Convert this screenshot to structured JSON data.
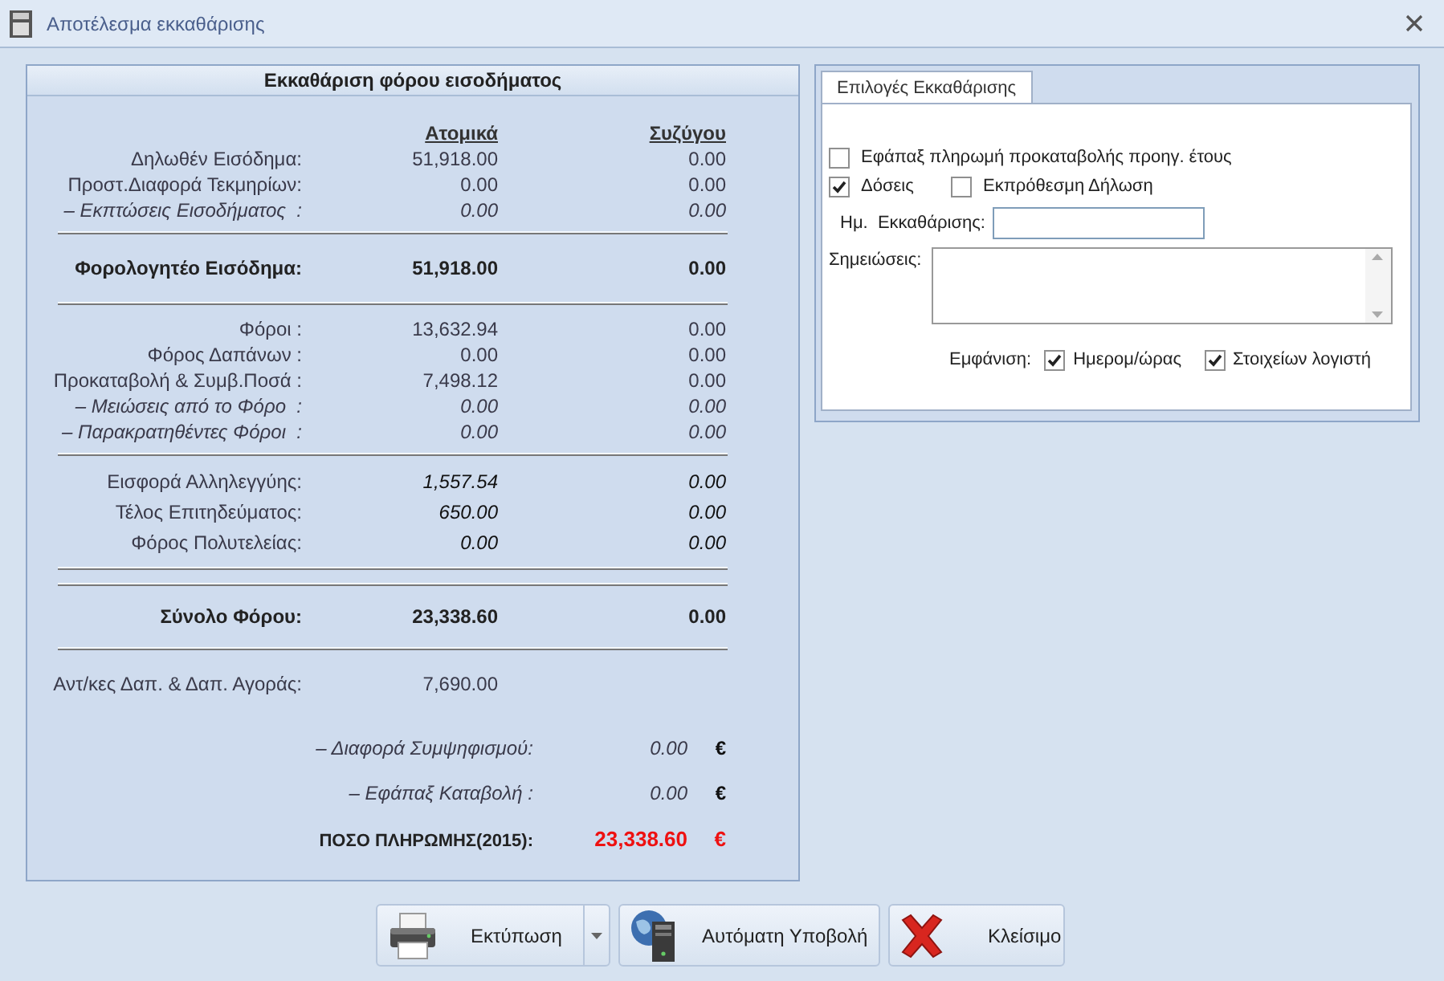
{
  "window": {
    "title": "Αποτέλεσμα εκκαθάρισης"
  },
  "summary": {
    "title": "Εκκαθάριση φόρου εισοδήματος",
    "columns": [
      "Ατομικά",
      "Συζύγου"
    ],
    "sections": [
      {
        "rows": [
          {
            "kind": "plain",
            "label": "Δηλωθέν Εισόδημα:",
            "individual": "51,918.00",
            "spouse": "0.00"
          },
          {
            "kind": "plain",
            "label": "Προστ.Διαφορά Τεκμηρίων:",
            "individual": "0.00",
            "spouse": "0.00"
          },
          {
            "kind": "deduction",
            "label": "– Εκπτώσεις Εισοδήματος  :",
            "individual": "0.00",
            "spouse": "0.00"
          }
        ]
      },
      {
        "rows": [
          {
            "kind": "total",
            "label": "Φορολογητέο Εισόδημα:",
            "individual": "51,918.00",
            "spouse": "0.00"
          }
        ]
      },
      {
        "rows": [
          {
            "kind": "plain",
            "label": "Φόροι :",
            "individual": "13,632.94",
            "spouse": "0.00"
          },
          {
            "kind": "plain",
            "label": "Φόρος Δαπάνων :",
            "individual": "0.00",
            "spouse": "0.00"
          },
          {
            "kind": "plain",
            "label": "Προκαταβολή & Συμβ.Ποσά :",
            "individual": "7,498.12",
            "spouse": "0.00"
          },
          {
            "kind": "deduction",
            "label": "– Μειώσεις από το Φόρο  :",
            "individual": "0.00",
            "spouse": "0.00"
          },
          {
            "kind": "deduction",
            "label": "– Παρακρατηθέντες Φόροι  :",
            "individual": "0.00",
            "spouse": "0.00"
          }
        ]
      },
      {
        "rows": [
          {
            "kind": "levy",
            "label": "Εισφορά Αλληλεγγύης:",
            "individual": "1,557.54",
            "spouse": "0.00"
          },
          {
            "kind": "levy",
            "label": "Τέλος Επιτηδεύματος:",
            "individual": "650.00",
            "spouse": "0.00"
          },
          {
            "kind": "levy",
            "label": "Φόρος Πολυτελείας:",
            "individual": "0.00",
            "spouse": "0.00"
          }
        ]
      },
      {
        "rows": [
          {
            "kind": "grand",
            "label": "Σύνολο Φόρου:",
            "individual": "23,338.60",
            "spouse": "0.00"
          }
        ]
      },
      {
        "rows": [
          {
            "kind": "note",
            "label": "Αντ/κες Δαπ. & Δαπ. Αγοράς:",
            "individual": "7,690.00"
          }
        ]
      }
    ],
    "payments": [
      {
        "kind": "deduction",
        "label": "– Διαφορά Συμψηφισμού:",
        "value": "0.00",
        "currency": "€"
      },
      {
        "kind": "deduction",
        "label": "– Εφάπαξ Καταβολή :",
        "value": "0.00",
        "currency": "€"
      },
      {
        "kind": "total",
        "label": "ΠΟΣΟ ΠΛΗΡΩΜΗΣ(2015):",
        "value": "23,338.60",
        "currency": "€"
      }
    ]
  },
  "options": {
    "tabs": [
      {
        "label": "Επιλογές Εκκαθάρισης",
        "selected": true
      }
    ],
    "lump_sum": {
      "label": "Εφάπαξ πληρωμή προκαταβολής προηγ. έτους",
      "checked": false
    },
    "installments": {
      "label": "Δόσεις",
      "checked": true
    },
    "late": {
      "label": "Εκπρόθεσμη Δήλωση",
      "checked": false
    },
    "date_label": "Ημ.  Εκκαθάρισης:",
    "notes_label": "Σημειώσεις:",
    "show_label": "Εμφάνιση:",
    "show": [
      {
        "label": "Ημερομ/ώρας",
        "checked": true
      },
      {
        "label": "Στοιχείων λογιστή",
        "checked": true
      }
    ]
  },
  "buttons": [
    {
      "kind": "print",
      "label": "Εκτύπωση"
    },
    {
      "kind": "submit",
      "label": "Αυτόματη Υποβολή"
    },
    {
      "kind": "close",
      "label": "Κλείσιμο"
    }
  ]
}
